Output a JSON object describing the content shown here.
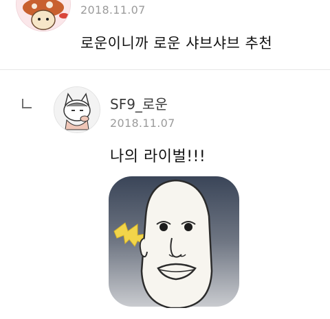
{
  "parent_comment": {
    "date": "2018.11.07",
    "text": "로운이니까 로운 샤브샤브 추천"
  },
  "reply": {
    "author": "SF9_로운",
    "date": "2018.11.07",
    "text": "나의 라이벌!!!"
  },
  "icons": {
    "reply_indicator": "reply-arrow-icon",
    "parent_avatar": "mushroom-character-avatar",
    "reply_avatar": "cat-character-avatar",
    "sticker": "pale-face-meme-sticker"
  }
}
